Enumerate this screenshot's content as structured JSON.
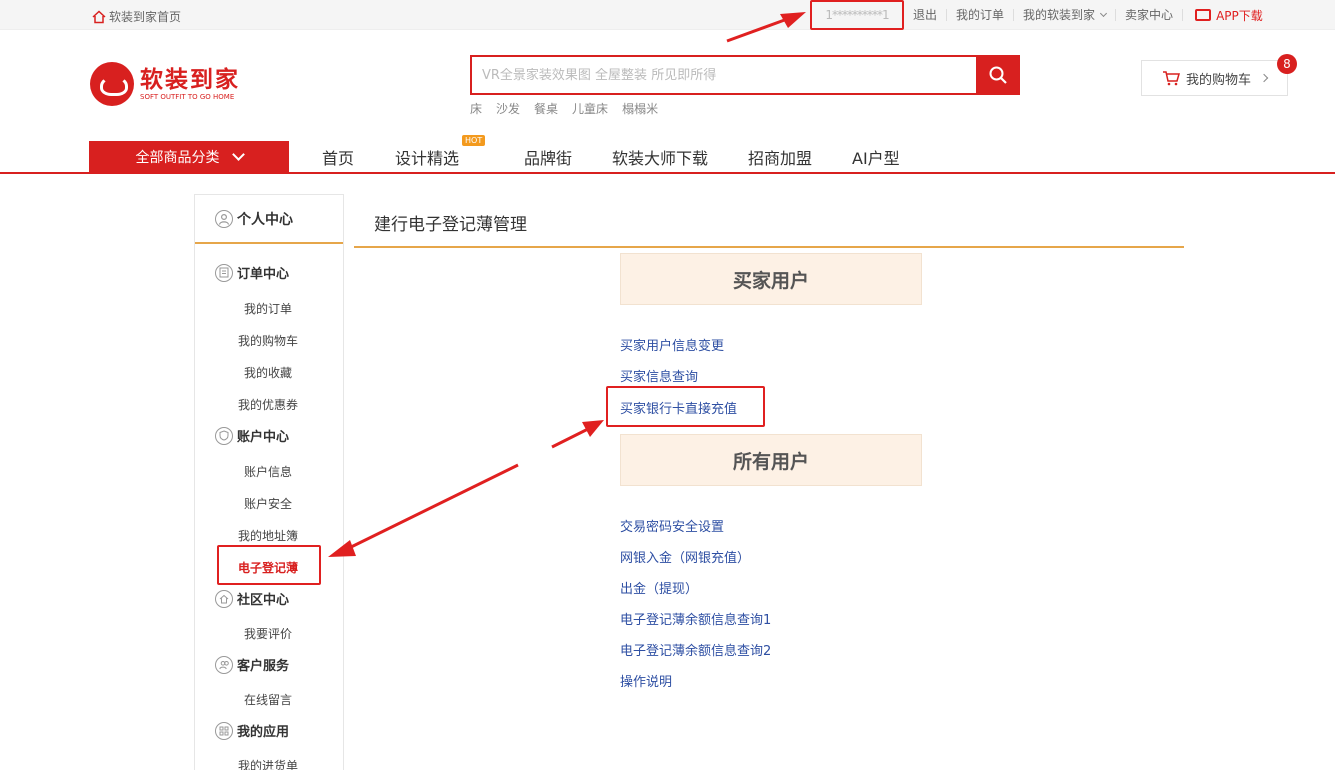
{
  "topbar": {
    "home_label": "软装到家首页",
    "user_masked": "1**********1",
    "logout": "退出",
    "my_orders": "我的订单",
    "my_home": "我的软装到家",
    "seller_center": "卖家中心",
    "app_download": "APP下载"
  },
  "header": {
    "logo_cn": "软装到家",
    "logo_en": "SOFT OUTFIT TO GO HOME",
    "search_placeholder": "VR全景家装效果图 全屋整装 所见即所得",
    "hot_words": [
      "床",
      "沙发",
      "餐桌",
      "儿童床",
      "榻榻米"
    ],
    "cart_label": "我的购物车",
    "cart_count": "8"
  },
  "nav": {
    "all_categories": "全部商品分类",
    "items": [
      "首页",
      "设计精选",
      "品牌街",
      "软装大师下载",
      "招商加盟",
      "AI户型"
    ],
    "hot_badge": "HOT"
  },
  "sidebar": {
    "title": "个人中心",
    "sections": [
      {
        "title": "订单中心",
        "icon": "document-icon",
        "items": [
          "我的订单",
          "我的购物车",
          "我的收藏",
          "我的优惠券"
        ]
      },
      {
        "title": "账户中心",
        "icon": "shield-icon",
        "items": [
          "账户信息",
          "账户安全",
          "我的地址簿",
          "电子登记薄"
        ]
      },
      {
        "title": "社区中心",
        "icon": "home-icon",
        "items": [
          "我要评价"
        ]
      },
      {
        "title": "客户服务",
        "icon": "users-icon",
        "items": [
          "在线留言"
        ]
      },
      {
        "title": "我的应用",
        "icon": "apps-icon",
        "items": [
          "我的进货单"
        ]
      }
    ],
    "active_item": "电子登记薄"
  },
  "main": {
    "title": "建行电子登记薄管理",
    "groups": [
      {
        "title": "买家用户",
        "links": [
          "买家用户信息变更",
          "买家信息查询",
          "买家银行卡直接充值"
        ]
      },
      {
        "title": "所有用户",
        "links": [
          "交易密码安全设置",
          "网银入金（网银充值）",
          "出金（提现）",
          "电子登记薄余额信息查询1",
          "电子登记薄余额信息查询2",
          "操作说明"
        ]
      }
    ]
  },
  "colors": {
    "brand": "#d8201f",
    "accent": "#e6a64a",
    "link": "#2e4fa3",
    "annotation": "#e02020"
  }
}
